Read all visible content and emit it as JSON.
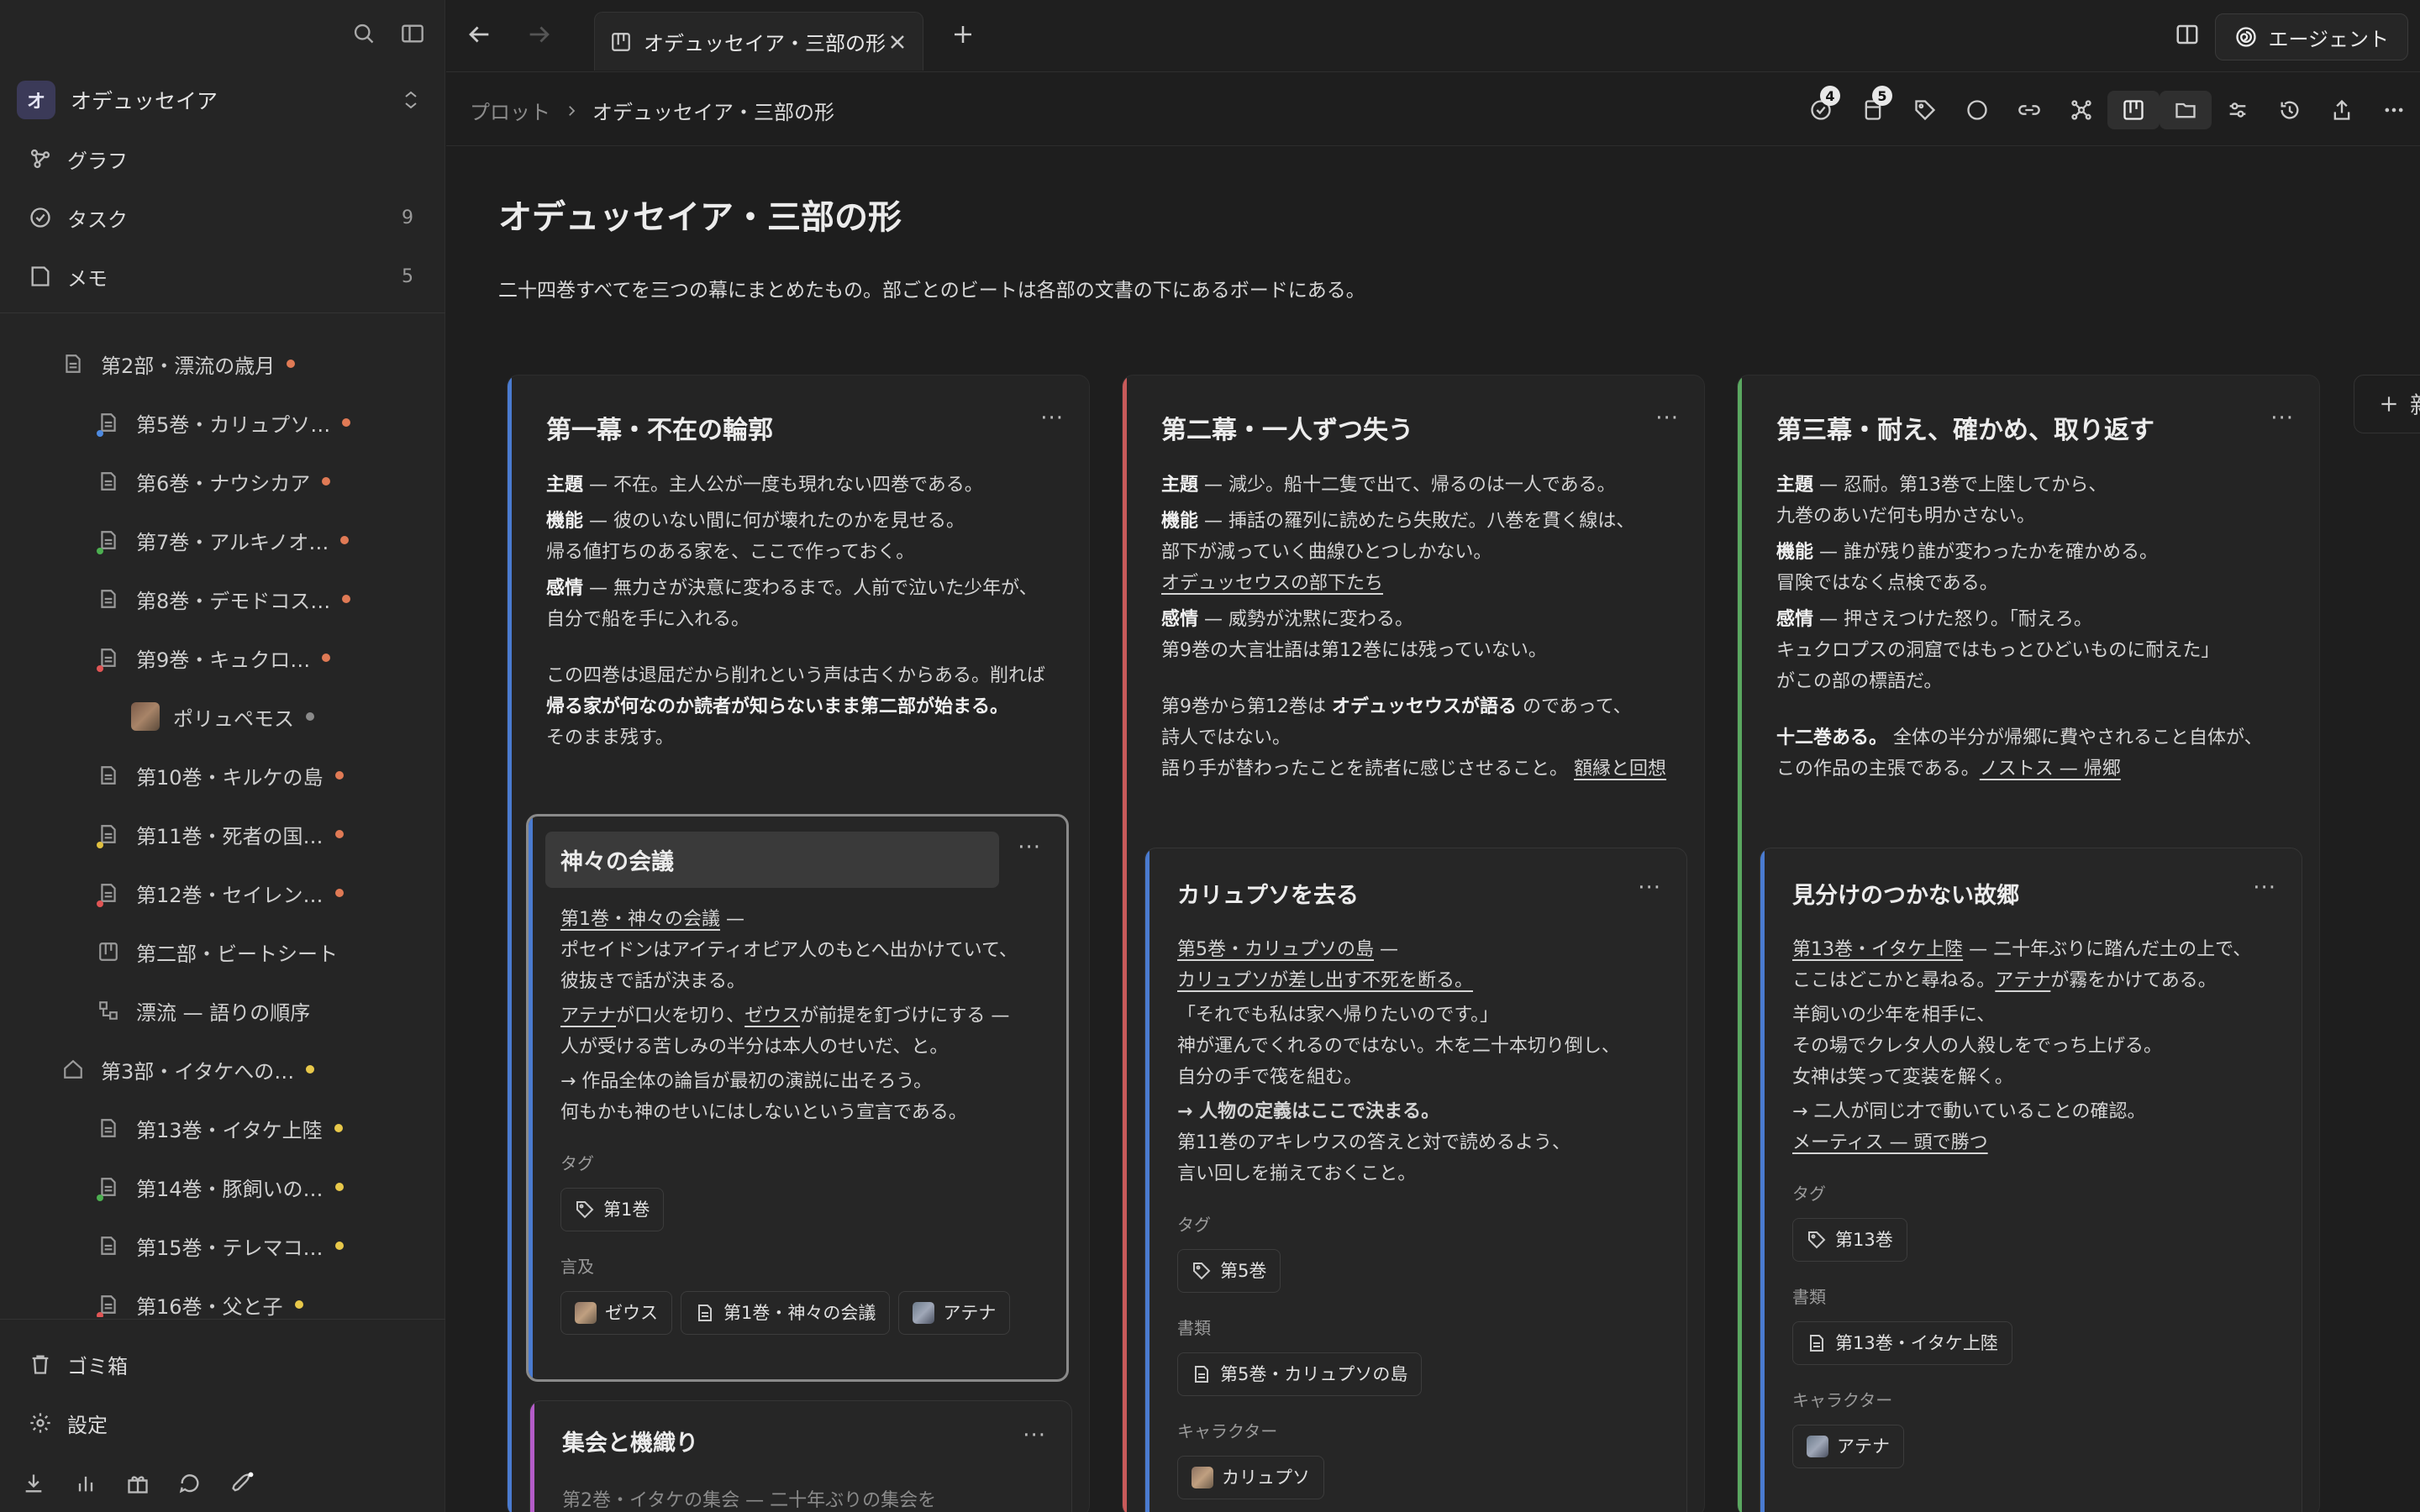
{
  "sidebar": {
    "workspace": {
      "avatar": "オ",
      "name": "オデュッセイア"
    },
    "nav": [
      {
        "label": "グラフ",
        "icon": "graph-icon",
        "count": ""
      },
      {
        "label": "タスク",
        "icon": "task-check-icon",
        "count": "9"
      },
      {
        "label": "メモ",
        "icon": "memo-icon",
        "count": "5"
      }
    ],
    "tree": [
      {
        "label": "第2部・漂流の歳月",
        "icon": "doc-icon",
        "indent": 0,
        "dot": "#e07a55"
      },
      {
        "label": "第5巻・カリュプソ…",
        "icon": "doc-icon",
        "indent": 1,
        "dot": "#e07a55",
        "mini": "#4e8ae0"
      },
      {
        "label": "第6巻・ナウシカア",
        "icon": "doc-icon",
        "indent": 1,
        "dot": "#e07a55"
      },
      {
        "label": "第7巻・アルキノオ…",
        "icon": "doc-icon",
        "indent": 1,
        "dot": "#e07a55",
        "mini": "#4caf50"
      },
      {
        "label": "第8巻・デモドコス…",
        "icon": "doc-icon",
        "indent": 1,
        "dot": "#e07a55"
      },
      {
        "label": "第9巻・キュクロ…",
        "icon": "doc-icon",
        "indent": 1,
        "dot": "#e07a55",
        "mini": "#e05555"
      },
      {
        "label": "ポリュペモス",
        "icon": "avatar",
        "indent": 2,
        "dot": "#8a8a8a"
      },
      {
        "label": "第10巻・キルケの島",
        "icon": "doc-icon",
        "indent": 1,
        "dot": "#e07a55"
      },
      {
        "label": "第11巻・死者の国…",
        "icon": "doc-icon",
        "indent": 1,
        "dot": "#e07a55",
        "mini": "#e0c040"
      },
      {
        "label": "第12巻・セイレン…",
        "icon": "doc-icon",
        "indent": 1,
        "dot": "#e07a55",
        "mini": "#e05555"
      },
      {
        "label": "第二部・ビートシート",
        "icon": "board-icon",
        "indent": 1,
        "dot": ""
      },
      {
        "label": "漂流 — 語りの順序",
        "icon": "flow-icon",
        "indent": 1,
        "dot": ""
      },
      {
        "label": "第3部・イタケへの…",
        "icon": "home-icon",
        "indent": 0,
        "dot": "#e8c84a"
      },
      {
        "label": "第13巻・イタケ上陸",
        "icon": "doc-icon",
        "indent": 1,
        "dot": "#e8c84a"
      },
      {
        "label": "第14巻・豚飼いの…",
        "icon": "doc-icon",
        "indent": 1,
        "dot": "#e8c84a",
        "mini": "#4caf50"
      },
      {
        "label": "第15巻・テレマコ…",
        "icon": "doc-icon",
        "indent": 1,
        "dot": "#e8c84a"
      },
      {
        "label": "第16巻・父と子",
        "icon": "doc-icon",
        "indent": 1,
        "dot": "#e8c84a",
        "mini": "#e05555"
      }
    ],
    "bottom": [
      {
        "label": "ゴミ箱",
        "icon": "trash-icon"
      },
      {
        "label": "設定",
        "icon": "gear-icon"
      }
    ]
  },
  "tabbar": {
    "tab_title": "オデュッセイア・三部の形",
    "agent_label": "エージェント"
  },
  "toolbar": {
    "breadcrumb_root": "プロット",
    "breadcrumb_current": "オデュッセイア・三部の形",
    "tasks_badge": "4",
    "docs_badge": "5"
  },
  "page": {
    "title": "オデュッセイア・三部の形",
    "description": "二十四巻すべてを三つの幕にまとめたもの。部ごとのビートは各部の文書の下にあるボードにある。",
    "add_column_label": "新"
  },
  "colors": {
    "act1": "#4a7bd0",
    "act2": "#c85a5a",
    "act3": "#5aa860",
    "card_purple": "#b45cc8",
    "accent_blue": "#4e8ae0"
  },
  "columns": [
    {
      "title": "第一幕・不在の輪郭",
      "lines": [
        [
          "主題",
          " — 不在。主人公が一度も現れない四巻である。"
        ],
        [
          "機能",
          " — 彼のいない間に何が壊れたのかを見せる。"
        ],
        [
          "",
          "帰る値打ちのある家を、ここで作っておく。"
        ],
        [
          "感情",
          " — 無力さが決意に変わるまで。人前で泣いた少年が、"
        ],
        [
          "",
          "自分で船を手に入れる。"
        ]
      ],
      "para2": [
        "この四巻は退屈だから削れという声は古くからある。削れば",
        "帰る家が何なのか読者が知らないまま第二部が始まる。",
        "そのまま残す。"
      ]
    },
    {
      "title": "第二幕・一人ずつ失う",
      "lines": [
        [
          "主題",
          " — 減少。船十二隻で出て、帰るのは一人である。"
        ],
        [
          "機能",
          " — 挿話の羅列に読めたら失敗だ。八巻を貫く線は、"
        ],
        [
          "",
          "部下が減っていく曲線ひとつしかない。"
        ],
        [
          "",
          "オデュッセウスの部下たち"
        ],
        [
          "感情",
          " — 威勢が沈黙に変わる。"
        ],
        [
          "",
          "第9巻の大言壮語は第12巻には残っていない。"
        ]
      ],
      "para2": [
        "第9巻から第12巻は",
        "オデュッセウスが語る",
        "のであって、",
        "詩人ではない。",
        "語り手が替わったことを読者に感じさせること。",
        "額縁と回想"
      ]
    },
    {
      "title": "第三幕・耐え、確かめ、取り返す",
      "lines": [
        [
          "主題",
          " — 忍耐。第13巻で上陸してから、"
        ],
        [
          "",
          "九巻のあいだ何も明かさない。"
        ],
        [
          "機能",
          " — 誰が残り誰が変わったかを確かめる。"
        ],
        [
          "",
          "冒険ではなく点検である。"
        ],
        [
          "感情",
          " — 押さえつけた怒り。「耐えろ。"
        ],
        [
          "",
          "キュクロプスの洞窟ではもっとひどいものに耐えた」"
        ],
        [
          "",
          "がこの部の標語だ。"
        ]
      ],
      "para2": [
        "十二巻ある。",
        "全体の半分が帰郷に費やされること自体が、",
        "この作品の主張である。",
        "ノストス — 帰郷"
      ]
    }
  ],
  "cards": {
    "c1": {
      "title": "神々の会議",
      "l1": "第1巻・神々の会議",
      "l1b": " —",
      "l2": "ポセイドンはアイティオピア人のもとへ出かけていて、",
      "l3": "彼抜きで話が決まる。",
      "l4a": "アテナ",
      "l4b": "が口火を切り、",
      "l4c": "ゼウス",
      "l4d": "が前提を釘づけにする —",
      "l5": "人が受ける苦しみの半分は本人のせいだ、と。",
      "l6": "→ 作品全体の論旨が最初の演説に出そろう。",
      "l7": "何もかも神のせいにはしないという宣言である。",
      "tag_label": "タグ",
      "tag": "第1巻",
      "mention_label": "言及",
      "m1": "ゼウス",
      "m2": "第1巻・神々の会議",
      "m3": "アテナ"
    },
    "c2": {
      "title": "カリュプソを去る",
      "l1": "第5巻・カリュプソの島",
      "l1b": " —",
      "l2": "カリュプソが差し出す不死を断る。",
      "l3": "「それでも私は家へ帰りたいのです。」",
      "l4": "神が運んでくれるのではない。木を二十本切り倒し、",
      "l5": "自分の手で筏を組む。",
      "l6": "→ 人物の定義はここで決まる。",
      "l7": "第11巻のアキレウスの答えと対で読めるよう、",
      "l8": "言い回しを揃えておくこと。",
      "tag_label": "タグ",
      "tag": "第5巻",
      "doc_label": "書類",
      "doc": "第5巻・カリュプソの島",
      "char_label": "キャラクター",
      "char": "カリュプソ"
    },
    "c3": {
      "title": "見分けのつかない故郷",
      "l1": "第13巻・イタケ上陸",
      "l1b": " — 二十年ぶりに踏んだ土の上で、",
      "l2a": "ここはどこかと尋ねる。",
      "l2b": "アテナ",
      "l2c": "が霧をかけてある。",
      "l3": "羊飼いの少年を相手に、",
      "l4": "その場でクレタ人の人殺しをでっち上げる。",
      "l5": "女神は笑って変装を解く。",
      "l6": "→ 二人が同じ才で動いていることの確認。",
      "l7": "メーティス — 頭で勝つ",
      "tag_label": "タグ",
      "tag": "第13巻",
      "doc_label": "書類",
      "doc": "第13巻・イタケ上陸",
      "char_label": "キャラクター",
      "char": "アテナ"
    },
    "c4": {
      "title": "集会と機織り",
      "preview": "第2巻・イタケの集会 — 二十年ぶりの集会を"
    }
  }
}
